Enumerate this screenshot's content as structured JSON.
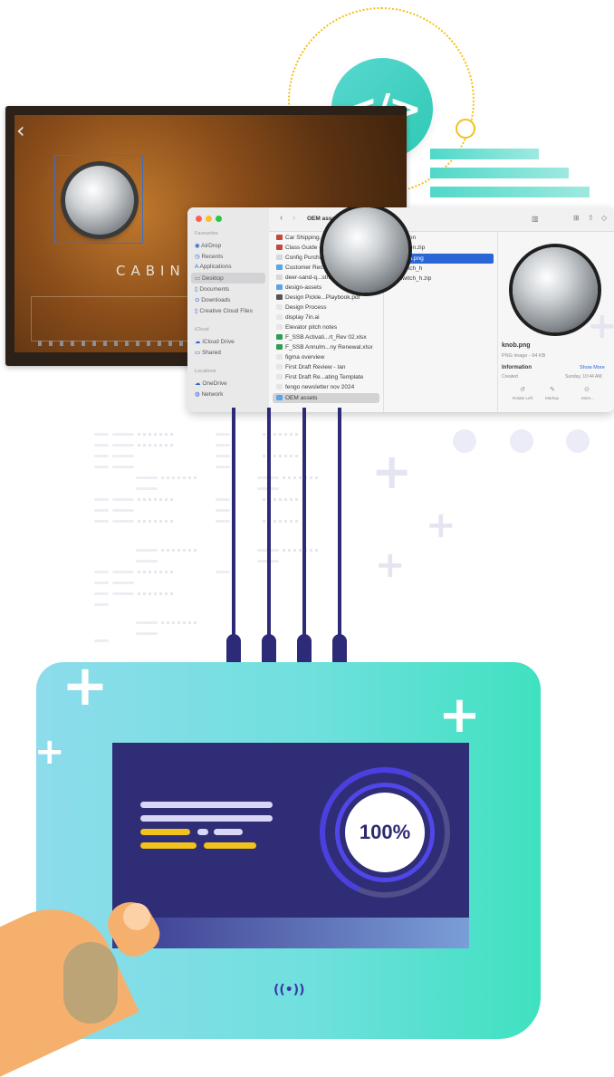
{
  "code_bubble": {
    "symbol": "</>"
  },
  "knob_app": {
    "back_icon": "chevron-left-icon",
    "brand_text": "CABIN"
  },
  "finder": {
    "title": "OEM assets",
    "sidebar": {
      "section_favourites": "Favourites",
      "items": [
        "AirDrop",
        "Recents",
        "Applications",
        "Desktop",
        "Documents",
        "Downloads",
        "Creative Cloud Files"
      ],
      "section_icloud": "iCloud",
      "icloud_items": [
        "iCloud Drive",
        "Shared"
      ],
      "section_locations": "Locations",
      "location_items": [
        "OneDrive",
        "Network"
      ]
    },
    "column1_items": [
      "Car Shipping...Transport.pdf",
      "Class Guide -...ments.pdf.pdf",
      "Config Purchase Receipt.pdf",
      "Customer Rec...nect Program",
      "deer-sand-q...structions.pdf",
      "design-assets",
      "Design Pickle...Playbook.pdf",
      "Design Process",
      "display 7in.ai",
      "Elevator pitch notes",
      "F_SSB Activati...rt_Rev 02.xlsx",
      "F_SSB Annulm...ny Renewal.xlsx",
      "figma overview",
      "First Draft Review - Ian",
      "First Draft Re...ating Template",
      "fengo newsletter nov 2024",
      "OEM assets"
    ],
    "column2_items": [
      "button",
      "button.zip",
      "knob.png",
      "switch_h",
      "switch_h.zip"
    ],
    "preview": {
      "filename": "knob.png",
      "meta": "PNG image - 64 KB",
      "info_label": "Information",
      "show_more": "Show More",
      "created_label": "Created",
      "created_value": "Sunday, 10:44 AM",
      "actions": [
        "Rotate Left",
        "Markup",
        "More..."
      ]
    }
  },
  "device": {
    "progress_percent": 100,
    "progress_label": "100%",
    "nfc_icon": "nfc-signal-icon",
    "nfc_symbol": "((•))"
  },
  "colors": {
    "accent_teal": "#3fe1c0",
    "accent_navy": "#302d77",
    "accent_yellow": "#f1c21b",
    "accent_purple": "#5147e8"
  }
}
